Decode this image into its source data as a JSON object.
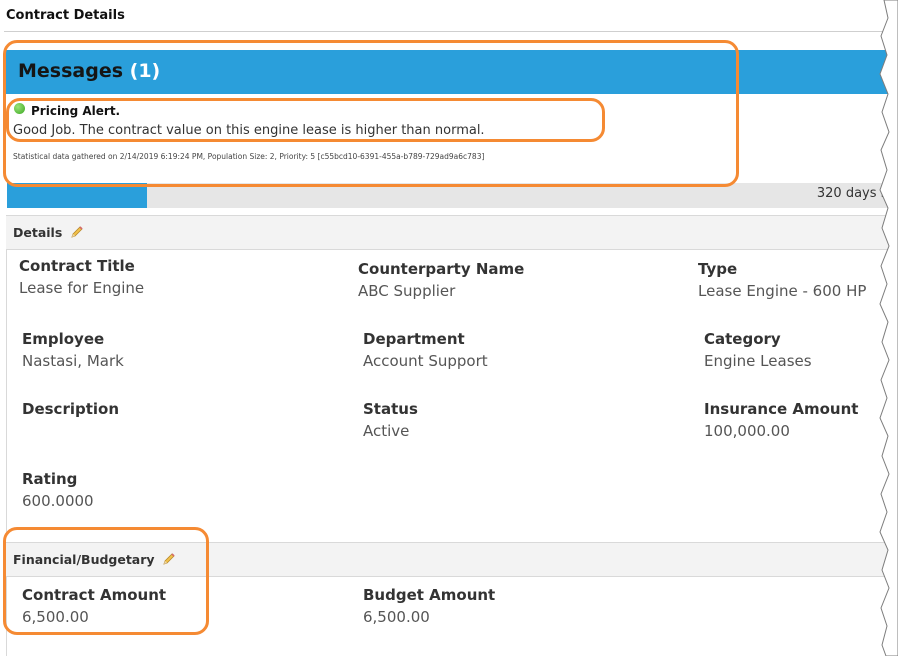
{
  "panel": {
    "title": "Contract Details"
  },
  "messages": {
    "title": "Messages",
    "count": "(1)",
    "alert": {
      "title": "Pricing Alert.",
      "body": "Good Job. The contract value on this engine lease is higher than normal.",
      "meta": "Statistical data gathered on 2/14/2019 6:19:24 PM, Population Size: 2, Priority: 5 [c55bcd10-6391-455a-b789-729ad9a6c783]",
      "status_color": "#3aa821"
    }
  },
  "progress": {
    "text": "320 days r",
    "fill_fraction": 0.157
  },
  "details": {
    "header": "Details",
    "fields": {
      "contract_title": {
        "label": "Contract Title",
        "value": "Lease for Engine"
      },
      "counterparty_name": {
        "label": "Counterparty Name",
        "value": "ABC Supplier"
      },
      "type": {
        "label": "Type",
        "value": "Lease Engine - 600 HP"
      },
      "employee": {
        "label": "Employee",
        "value": "Nastasi, Mark"
      },
      "department": {
        "label": "Department",
        "value": "Account Support"
      },
      "category": {
        "label": "Category",
        "value": "Engine Leases"
      },
      "description": {
        "label": "Description",
        "value": ""
      },
      "status": {
        "label": "Status",
        "value": "Active"
      },
      "insurance_amount": {
        "label": "Insurance Amount",
        "value": "100,000.00"
      },
      "rating": {
        "label": "Rating",
        "value": "600.0000"
      }
    }
  },
  "financial": {
    "header": "Financial/Budgetary",
    "fields": {
      "contract_amount": {
        "label": "Contract Amount",
        "value": "6,500.00"
      },
      "budget_amount": {
        "label": "Budget Amount",
        "value": "6,500.00"
      }
    }
  },
  "colors": {
    "accent_blue": "#2a9fdb",
    "annotation_orange": "#f58a33"
  },
  "icons": [
    "pencil-icon",
    "status-dot-icon"
  ]
}
